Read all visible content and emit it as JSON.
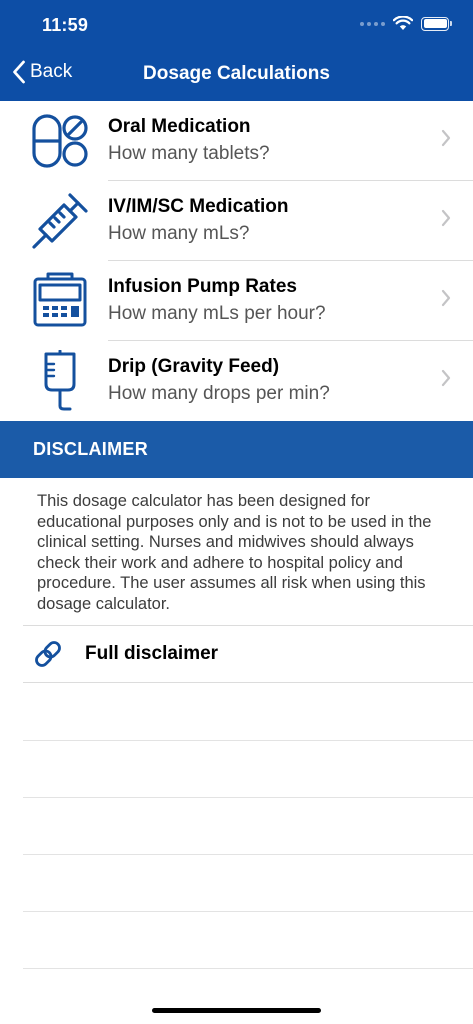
{
  "status_bar": {
    "time": "11:59"
  },
  "nav": {
    "back_label": "Back",
    "title": "Dosage Calculations"
  },
  "menu": {
    "items": [
      {
        "title": "Oral Medication",
        "subtitle": "How many tablets?",
        "icon": "pills-icon"
      },
      {
        "title": "IV/IM/SC Medication",
        "subtitle": "How many mLs?",
        "icon": "syringe-icon"
      },
      {
        "title": "Infusion Pump Rates",
        "subtitle": "How many mLs per hour?",
        "icon": "infusion-pump-icon"
      },
      {
        "title": "Drip (Gravity Feed)",
        "subtitle": "How many drops per min?",
        "icon": "iv-drip-icon"
      }
    ]
  },
  "disclaimer": {
    "header": "DISCLAIMER",
    "body": "This dosage calculator has been designed for educational purposes only and is not to be used in the clinical setting. Nurses and midwives should always check their work and adhere to hospital policy and procedure. The user assumes all risk when using this dosage calculator.",
    "link_label": "Full disclaimer"
  },
  "colors": {
    "primary": "#0d4ea6",
    "section_header": "#1b5ba8",
    "icon_blue": "#14509e"
  }
}
